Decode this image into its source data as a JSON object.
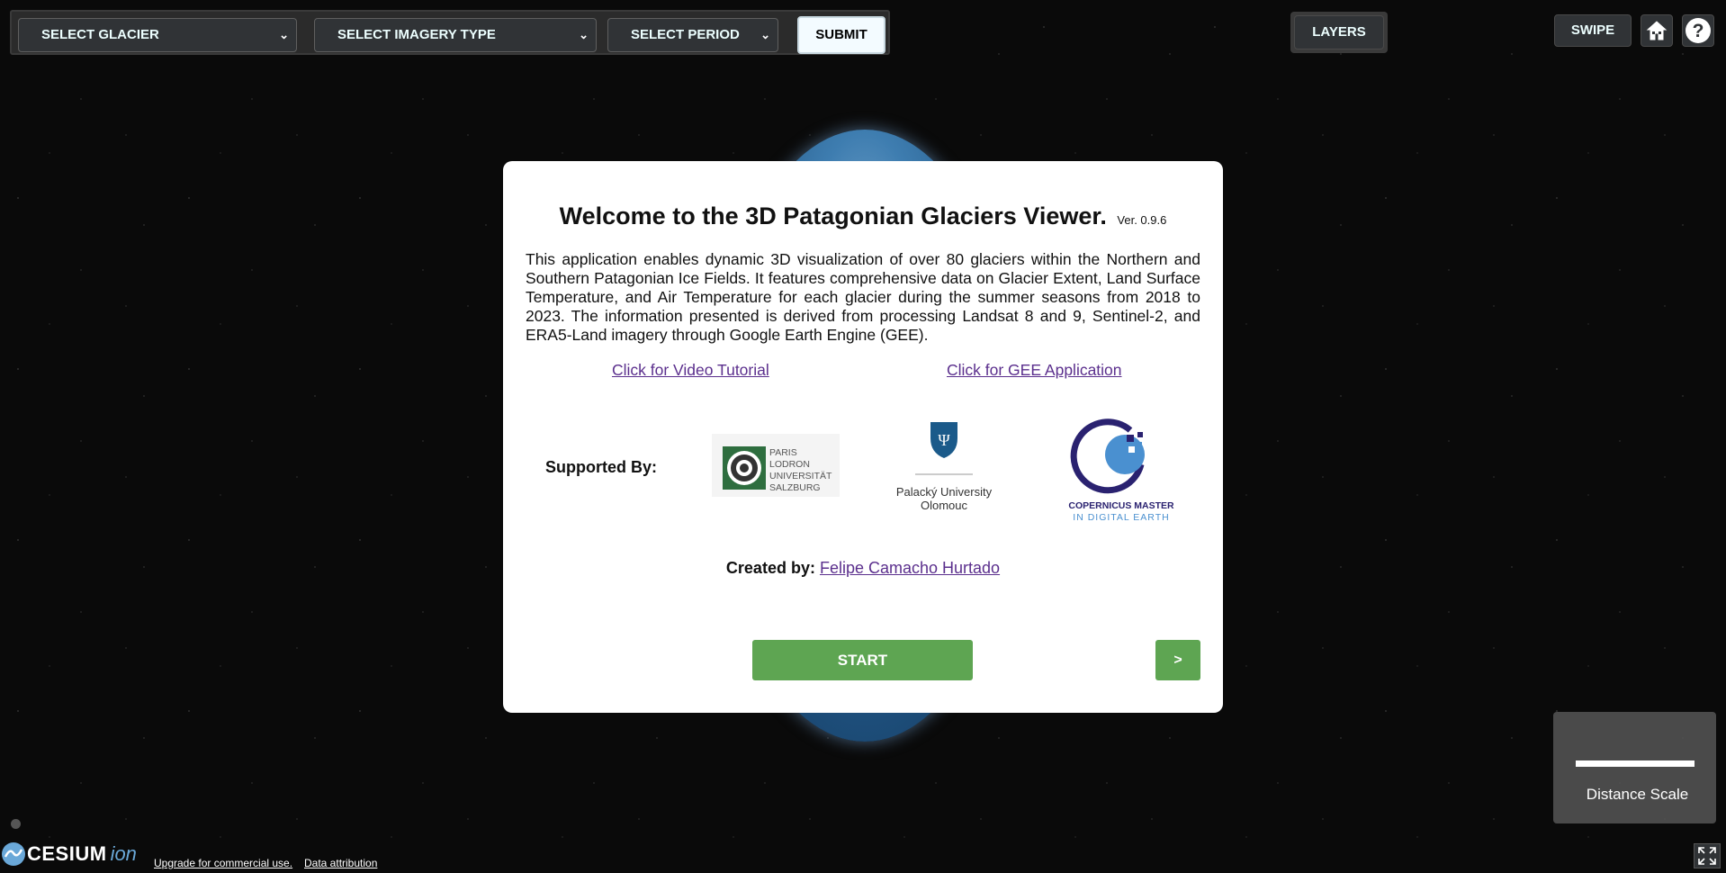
{
  "toolbar": {
    "select_glacier": "SELECT GLACIER",
    "select_imagery": "SELECT IMAGERY TYPE",
    "select_period": "SELECT PERIOD",
    "submit": "SUBMIT"
  },
  "top_right": {
    "layers": "LAYERS",
    "swipe": "SWIPE",
    "home_icon": "home-icon",
    "help_icon": "help-icon"
  },
  "modal": {
    "title": "Welcome to the 3D Patagonian Glaciers Viewer.",
    "version": "Ver. 0.9.6",
    "description": "This application enables dynamic 3D visualization of over 80 glaciers within the Northern and Southern Patagonian Ice Fields. It features comprehensive data on Glacier Extent, Land Surface Temperature, and Air Temperature for each glacier during the summer seasons from 2018 to 2023. The information presented is derived from processing Landsat 8 and 9, Sentinel-2, and ERA5-Land imagery through Google Earth Engine (GEE).",
    "video_link": "Click for Video Tutorial",
    "gee_link": "Click for GEE Application",
    "supported_by": "Supported By:",
    "logos": {
      "plus_lines": [
        "PARIS",
        "LODRON",
        "UNIVERSITÄT",
        "SALZBURG"
      ],
      "palacky_line1": "Palacký University",
      "palacky_line2": "Olomouc",
      "copernicus_line1": "COPERNICUS MASTER",
      "copernicus_line2": "IN DIGITAL EARTH"
    },
    "created_by_label": "Created by:",
    "created_by_name": "Felipe Camacho Hurtado",
    "start": "START",
    "next": ">"
  },
  "distance_scale": {
    "label": "Distance Scale"
  },
  "footer": {
    "cesium": "CESIUM",
    "ion": "ion",
    "upgrade": "Upgrade for commercial use.",
    "attribution": "Data attribution"
  },
  "colors": {
    "start_green": "#5ea552",
    "link_purple": "#5b2f8d",
    "copernicus_navy": "#2a2270",
    "copernicus_blue": "#4a90d0"
  }
}
